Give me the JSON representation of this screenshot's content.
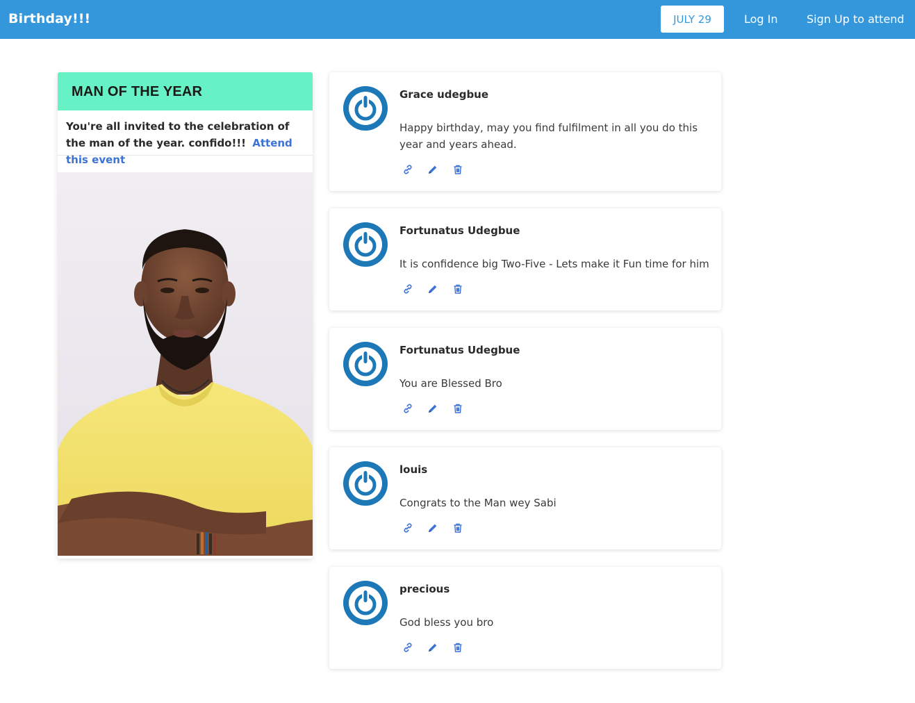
{
  "navbar": {
    "brand": "Birthday!!!",
    "date_button": "JULY 29",
    "login": "Log In",
    "signup": "Sign Up to attend"
  },
  "event": {
    "title": "MAN OF THE YEAR",
    "description": "You're all invited to the celebration of the man of the year. confido!!!",
    "attend_link": "Attend this event",
    "photo_alt": "man in yellow t-shirt portrait"
  },
  "colors": {
    "navbar": "#3497db",
    "event_header": "#66f2c4",
    "link": "#3b73d6",
    "avatar": "#1d78b8",
    "action_icons": "#3b73d6"
  },
  "comments": [
    {
      "name": "Grace udegbue",
      "text": "Happy birthday, may you find fulfilment in all you do this year and years ahead."
    },
    {
      "name": "Fortunatus Udegbue",
      "text": "It is confidence big Two-Five - Lets make it Fun time for him"
    },
    {
      "name": "Fortunatus Udegbue",
      "text": "You are Blessed Bro"
    },
    {
      "name": "louis",
      "text": "Congrats to the Man wey Sabi"
    },
    {
      "name": "precious",
      "text": "God bless you bro"
    }
  ],
  "comment_icons": [
    "link-icon",
    "pencil-icon",
    "trash-icon"
  ]
}
